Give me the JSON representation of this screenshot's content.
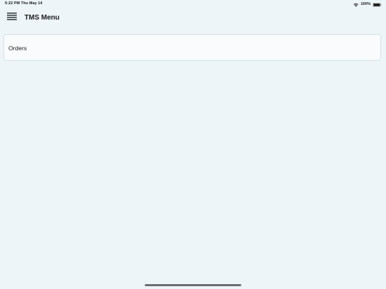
{
  "status_bar": {
    "time": "5:22 PM",
    "date": "Thu May 14",
    "battery_percent": "100%",
    "battery_level": 1.0,
    "wifi_icon": "wifi-icon",
    "battery_icon": "battery-icon"
  },
  "header": {
    "title": "TMS Menu",
    "menu_icon": "hamburger-menu-icon"
  },
  "menu": {
    "items": [
      {
        "label": "Orders"
      }
    ]
  }
}
